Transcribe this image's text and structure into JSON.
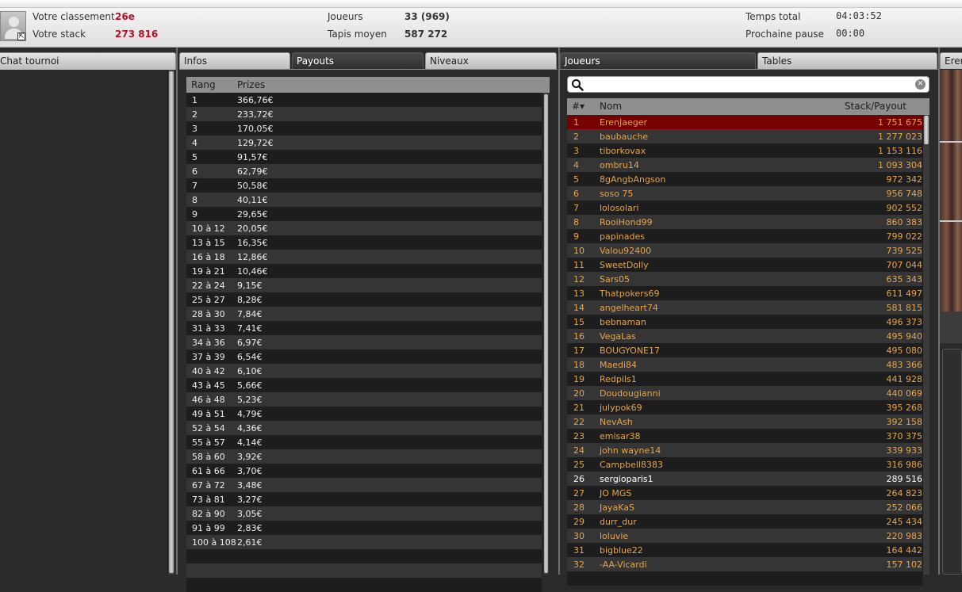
{
  "header": {
    "rank_label": "Votre classement",
    "rank_value": "26e",
    "stack_label": "Votre stack",
    "stack_value": "273 816",
    "players_label": "Joueurs",
    "players_value": "33 (969)",
    "avg_label": "Tapis moyen",
    "avg_value": "587 272",
    "total_time_label": "Temps total",
    "total_time_value": "04:03:52",
    "next_break_label": "Prochaine pause",
    "next_break_value": "00:00"
  },
  "colors": {
    "accent_red": "#b3122a",
    "highlight_row": "#760000",
    "player_name": "#e5a54c"
  },
  "tabs": {
    "chat": "Chat tournoi",
    "infos": "Infos",
    "payouts": "Payouts",
    "niveaux": "Niveaux",
    "joueurs": "Joueurs",
    "tables": "Tables",
    "right_partial": "Eren"
  },
  "payouts": {
    "headers": [
      "Rang",
      "Prizes"
    ],
    "rows": [
      [
        "1",
        "366,76€"
      ],
      [
        "2",
        "233,72€"
      ],
      [
        "3",
        "170,05€"
      ],
      [
        "4",
        "129,72€"
      ],
      [
        "5",
        "91,57€"
      ],
      [
        "6",
        "62,79€"
      ],
      [
        "7",
        "50,58€"
      ],
      [
        "8",
        "40,11€"
      ],
      [
        "9",
        "29,65€"
      ],
      [
        "10 à 12",
        "20,05€"
      ],
      [
        "13 à 15",
        "16,35€"
      ],
      [
        "16 à 18",
        "12,86€"
      ],
      [
        "19 à 21",
        "10,46€"
      ],
      [
        "22 à 24",
        "9,15€"
      ],
      [
        "25 à 27",
        "8,28€"
      ],
      [
        "28 à 30",
        "7,84€"
      ],
      [
        "31 à 33",
        "7,41€"
      ],
      [
        "34 à 36",
        "6,97€"
      ],
      [
        "37 à 39",
        "6,54€"
      ],
      [
        "40 à 42",
        "6,10€"
      ],
      [
        "43 à 45",
        "5,66€"
      ],
      [
        "46 à 48",
        "5,23€"
      ],
      [
        "49 à 51",
        "4,79€"
      ],
      [
        "52 à 54",
        "4,36€"
      ],
      [
        "55 à 57",
        "4,14€"
      ],
      [
        "58 à 60",
        "3,92€"
      ],
      [
        "61 à 66",
        "3,70€"
      ],
      [
        "67 à 72",
        "3,48€"
      ],
      [
        "73 à 81",
        "3,27€"
      ],
      [
        "82 à 90",
        "3,05€"
      ],
      [
        "91 à 99",
        "2,83€"
      ],
      [
        "100 à 108",
        "2,61€"
      ],
      [
        "",
        ""
      ],
      [
        "",
        ""
      ],
      [
        "",
        ""
      ]
    ]
  },
  "players": {
    "search_placeholder": "",
    "headers": {
      "rank": "#▾",
      "name": "Nom",
      "stack": "Stack/Payout"
    },
    "rows": [
      [
        "1",
        "ErenJaeger",
        "1 751 675"
      ],
      [
        "2",
        "baubauche",
        "1 277 023"
      ],
      [
        "3",
        "tiborkovax",
        "1 153 116"
      ],
      [
        "4",
        "ombru14",
        "1 093 304"
      ],
      [
        "5",
        "8gAngbAngson",
        "972 342"
      ],
      [
        "6",
        "soso 75",
        "956 748"
      ],
      [
        "7",
        "lolosolari",
        "902 552"
      ],
      [
        "8",
        "RooiHond99",
        "860 383"
      ],
      [
        "9",
        "papinades",
        "799 022"
      ],
      [
        "10",
        "Valou92400",
        "739 525"
      ],
      [
        "11",
        "SweetDolly",
        "707 044"
      ],
      [
        "12",
        "Sars05",
        "635 343"
      ],
      [
        "13",
        "Thatpokers69",
        "611 497"
      ],
      [
        "14",
        "angelheart74",
        "581 815"
      ],
      [
        "15",
        "bebnaman",
        "496 373"
      ],
      [
        "16",
        "VegaLas",
        "495 940"
      ],
      [
        "17",
        "BOUGYONE17",
        "495 080"
      ],
      [
        "18",
        "Maedi84",
        "483 366"
      ],
      [
        "19",
        "Redpils1",
        "441 928"
      ],
      [
        "20",
        "Doudougianni",
        "440 069"
      ],
      [
        "21",
        "julypok69",
        "395 268"
      ],
      [
        "22",
        "NevAsh",
        "392 158"
      ],
      [
        "23",
        "emisar38",
        "370 375"
      ],
      [
        "24",
        "john wayne14",
        "339 933"
      ],
      [
        "25",
        "Campbell8383",
        "316 986"
      ],
      [
        "26",
        "sergioparis1",
        "289 516"
      ],
      [
        "27",
        "JO MGS",
        "264 823"
      ],
      [
        "28",
        "JayaKaS",
        "252 066"
      ],
      [
        "29",
        "durr_dur",
        "245 434"
      ],
      [
        "30",
        "loluvie",
        "220 983"
      ],
      [
        "31",
        "bigblue22",
        "164 442"
      ],
      [
        "32",
        "-AA-Vicardi",
        "157 102"
      ],
      [
        "",
        "",
        ""
      ]
    ]
  }
}
